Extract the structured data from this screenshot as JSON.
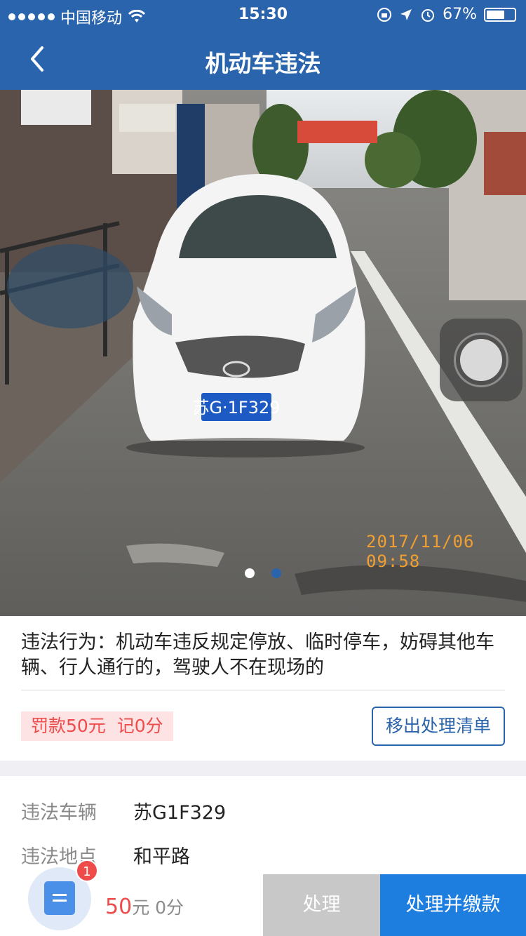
{
  "status_bar": {
    "carrier": "中国移动",
    "time": "15:30",
    "battery": "67%",
    "battery_level": 0.67
  },
  "nav": {
    "title": "机动车违法"
  },
  "photo": {
    "timestamp": "2017/11/06 09:58",
    "plate_in_photo": "苏G·1F329",
    "pages": 2,
    "active_page": 2
  },
  "violation": {
    "description": "违法行为：机动车违反规定停放、临时停车，妨碍其他车辆、行人通行的，驾驶人不在现场的",
    "fine_label": "罚款50元  记0分",
    "remove_button": "移出处理清单"
  },
  "details": {
    "vehicle_label": "违法车辆",
    "vehicle_value": "苏G1F329",
    "location_label": "违法地点",
    "location_value": "和平路"
  },
  "bottom": {
    "badge_count": "1",
    "price": "50",
    "price_unit": "元 0分",
    "process_button": "处理",
    "pay_button": "处理并缴款"
  },
  "colors": {
    "brand": "#2a64ad",
    "accent": "#1e7ee0",
    "fine_text": "#ee4b4b",
    "fine_bg": "#fde3e3"
  }
}
